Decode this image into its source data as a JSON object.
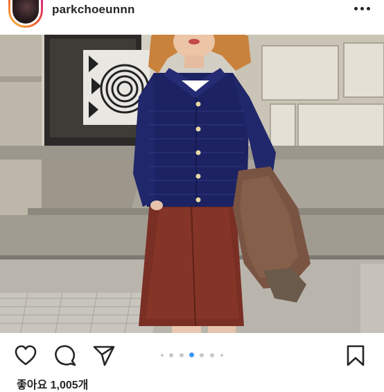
{
  "post": {
    "username": "parkchoeunnn",
    "likes_text": "좋아요 1,005개"
  },
  "header": {
    "avatar_icon": "avatar",
    "more_icon": "more-horizontal-icon"
  },
  "actions": {
    "like_icon": "heart-icon",
    "comment_icon": "comment-icon",
    "share_icon": "send-icon",
    "save_icon": "bookmark-icon"
  },
  "carousel": {
    "total_dots": 7,
    "active_index": 3,
    "active_color": "#3897f0",
    "inactive_color": "#c7c7c7"
  }
}
